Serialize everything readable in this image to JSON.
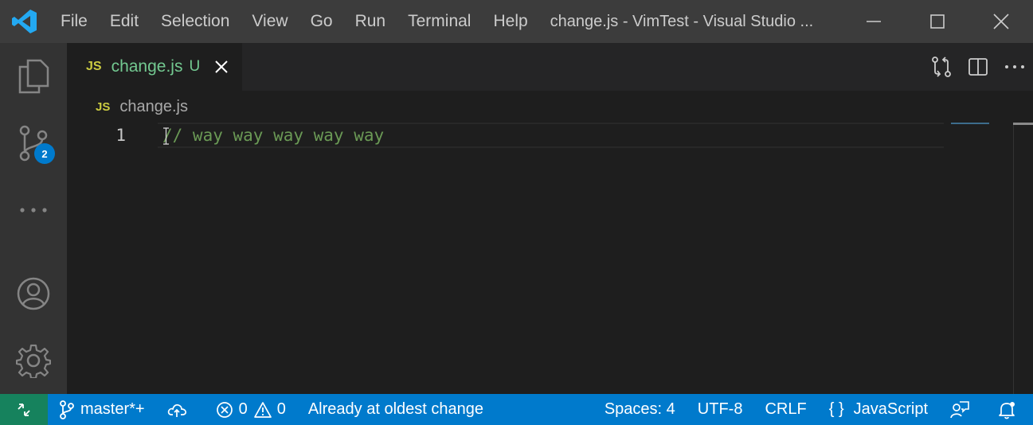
{
  "titlebar": {
    "menu": [
      "File",
      "Edit",
      "Selection",
      "View",
      "Go",
      "Run",
      "Terminal",
      "Help"
    ],
    "window_title": "change.js - VimTest - Visual Studio ..."
  },
  "activitybar": {
    "items": [
      "explorer-icon",
      "source-control-icon",
      "more-icon",
      "account-icon",
      "gear-icon"
    ],
    "scm_badge": "2"
  },
  "tab": {
    "icon_text": "JS",
    "label": "change.js",
    "status": "U"
  },
  "breadcrumb": {
    "icon_text": "JS",
    "label": "change.js"
  },
  "editor": {
    "line_number": "1",
    "code": "// way way way way way"
  },
  "statusbar": {
    "branch": "master*+",
    "errors": "0",
    "warnings": "0",
    "message": "Already at oldest change",
    "spaces": "Spaces: 4",
    "encoding": "UTF-8",
    "eol": "CRLF",
    "language_icon": "{ }",
    "language": "JavaScript"
  },
  "colors": {
    "titlebar": "#3c3c3c",
    "activitybar": "#333333",
    "editor": "#1e1e1e",
    "statusbar": "#007acc",
    "remote": "#16825d",
    "comment": "#6a9955",
    "untracked": "#73c991",
    "js_icon": "#cbcb41"
  }
}
